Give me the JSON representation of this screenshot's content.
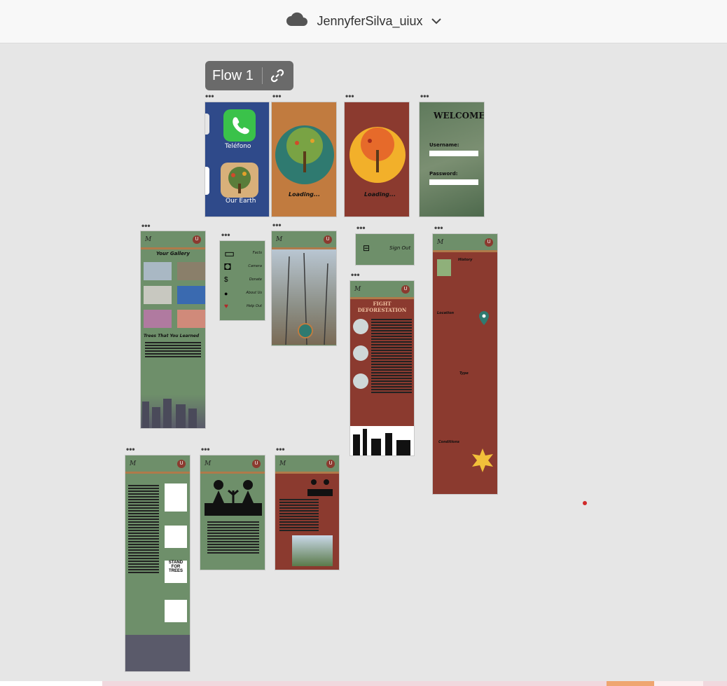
{
  "header": {
    "account_name": "JennyferSilva_uiux",
    "icons": {
      "cloud": "cloud-icon",
      "chevron": "chevron-down-icon"
    }
  },
  "flow": {
    "label": "Flow 1",
    "link_icon": "link-icon"
  },
  "artboards": {
    "home_screen": {
      "app1": "Teléfono",
      "app2": "Our Earth"
    },
    "loading1": {
      "text": "Loading..."
    },
    "loading2": {
      "text": "Loading..."
    },
    "login": {
      "title": "WELCOME",
      "username_label": "Username:",
      "password_label": "Password:"
    },
    "gallery": {
      "title": "Your Gallery",
      "section": "Trees That You Learned"
    },
    "menu": {
      "items": [
        "Facts",
        "Camera",
        "Donate",
        "About Us",
        "Help Out"
      ]
    },
    "signout": {
      "text": "Sign Out"
    },
    "deforestation": {
      "title": "FIGHT DEFORESTATION"
    },
    "map_facts": {
      "sections": [
        "History",
        "Location",
        "Type",
        "Conditions"
      ]
    },
    "charity": {
      "logo_text": "STAND FOR TREES"
    }
  },
  "colors": {
    "canvas": "#e6e6e6",
    "green": "#6e8f6a",
    "rust": "#8b3a2f",
    "orange": "#c17b3f"
  }
}
